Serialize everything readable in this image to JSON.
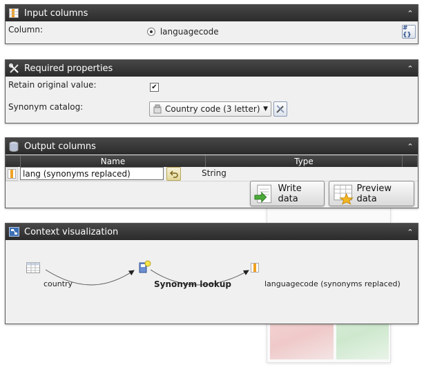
{
  "input_columns": {
    "title": "Input columns",
    "column_label": "Column:",
    "column_value": "languagecode",
    "button_text": "#{}"
  },
  "required_properties": {
    "title": "Required properties",
    "retain_label": "Retain original value:",
    "retain_checked": true,
    "catalog_label": "Synonym catalog:",
    "catalog_value": "Country code (3 letter)"
  },
  "output_columns": {
    "title": "Output columns",
    "headers": {
      "name": "Name",
      "type": "Type"
    },
    "row": {
      "name": "lang (synonyms replaced)",
      "type": "String"
    },
    "write_data": "Write data",
    "preview_data": "Preview data"
  },
  "context_visualization": {
    "title": "Context visualization",
    "source": "country",
    "transform": "Synonym lookup",
    "output": "languagecode (synonyms replaced)"
  },
  "colors": {
    "header_bg": "#2b2b2b",
    "panel_bg": "#f0f0f0",
    "accent_blue": "#2a4c8a"
  }
}
